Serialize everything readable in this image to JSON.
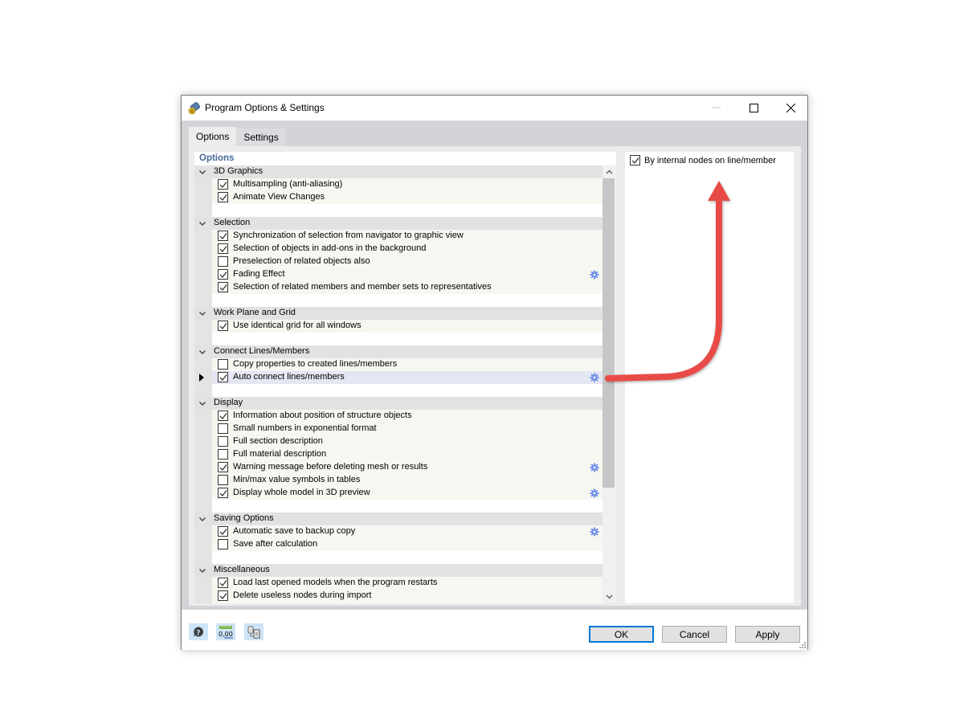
{
  "window": {
    "title": "Program Options & Settings",
    "controls": {
      "minimize": "minimize",
      "maximize": "maximize",
      "close": "close"
    }
  },
  "tabs": [
    {
      "label": "Options",
      "active": true
    },
    {
      "label": "Settings",
      "active": false
    }
  ],
  "options_pane": {
    "header": "Options",
    "groups": [
      {
        "title": "3D Graphics",
        "items": [
          {
            "label": "Multisampling (anti-aliasing)",
            "checked": true,
            "gear": false
          },
          {
            "label": "Animate View Changes",
            "checked": true,
            "gear": false
          }
        ]
      },
      {
        "title": "Selection",
        "items": [
          {
            "label": "Synchronization of selection from navigator to graphic view",
            "checked": true,
            "gear": false
          },
          {
            "label": "Selection of objects in add-ons in the background",
            "checked": true,
            "gear": false
          },
          {
            "label": "Preselection of related objects also",
            "checked": false,
            "gear": false
          },
          {
            "label": "Fading Effect",
            "checked": true,
            "gear": true
          },
          {
            "label": "Selection of related members and member sets to representatives",
            "checked": true,
            "gear": false
          }
        ]
      },
      {
        "title": "Work Plane and Grid",
        "items": [
          {
            "label": "Use identical grid for all windows",
            "checked": true,
            "gear": false
          }
        ]
      },
      {
        "title": "Connect Lines/Members",
        "items": [
          {
            "label": "Copy properties to created lines/members",
            "checked": false,
            "gear": false
          },
          {
            "label": "Auto connect lines/members",
            "checked": true,
            "gear": true,
            "selected": true
          }
        ]
      },
      {
        "title": "Display",
        "items": [
          {
            "label": "Information about position of structure objects",
            "checked": true,
            "gear": false
          },
          {
            "label": "Small numbers in exponential format",
            "checked": false,
            "gear": false
          },
          {
            "label": "Full section description",
            "checked": false,
            "gear": false
          },
          {
            "label": "Full material description",
            "checked": false,
            "gear": false
          },
          {
            "label": "Warning message before deleting mesh or results",
            "checked": true,
            "gear": true
          },
          {
            "label": "Min/max value symbols in tables",
            "checked": false,
            "gear": false
          },
          {
            "label": "Display whole model in 3D preview",
            "checked": true,
            "gear": true
          }
        ]
      },
      {
        "title": "Saving Options",
        "items": [
          {
            "label": "Automatic save to backup copy",
            "checked": true,
            "gear": true
          },
          {
            "label": "Save after calculation",
            "checked": false,
            "gear": false
          }
        ]
      },
      {
        "title": "Miscellaneous",
        "items": [
          {
            "label": "Load last opened models when the program restarts",
            "checked": true,
            "gear": false
          },
          {
            "label": "Delete useless nodes during import",
            "checked": true,
            "gear": false
          }
        ]
      }
    ]
  },
  "detail_pane": {
    "items": [
      {
        "label": "By internal nodes on line/member",
        "checked": true
      }
    ]
  },
  "footer": {
    "tools": [
      {
        "name": "help-icon"
      },
      {
        "name": "units-decimals-icon",
        "text": "0,00"
      },
      {
        "name": "copy-settings-icon"
      }
    ],
    "buttons": {
      "ok": "OK",
      "cancel": "Cancel",
      "apply": "Apply"
    }
  },
  "colors": {
    "accent": "#0078d7",
    "pane_header": "#4a6a9a",
    "gear": "#6f8fe8",
    "annotation_arrow": "#e84b47"
  }
}
